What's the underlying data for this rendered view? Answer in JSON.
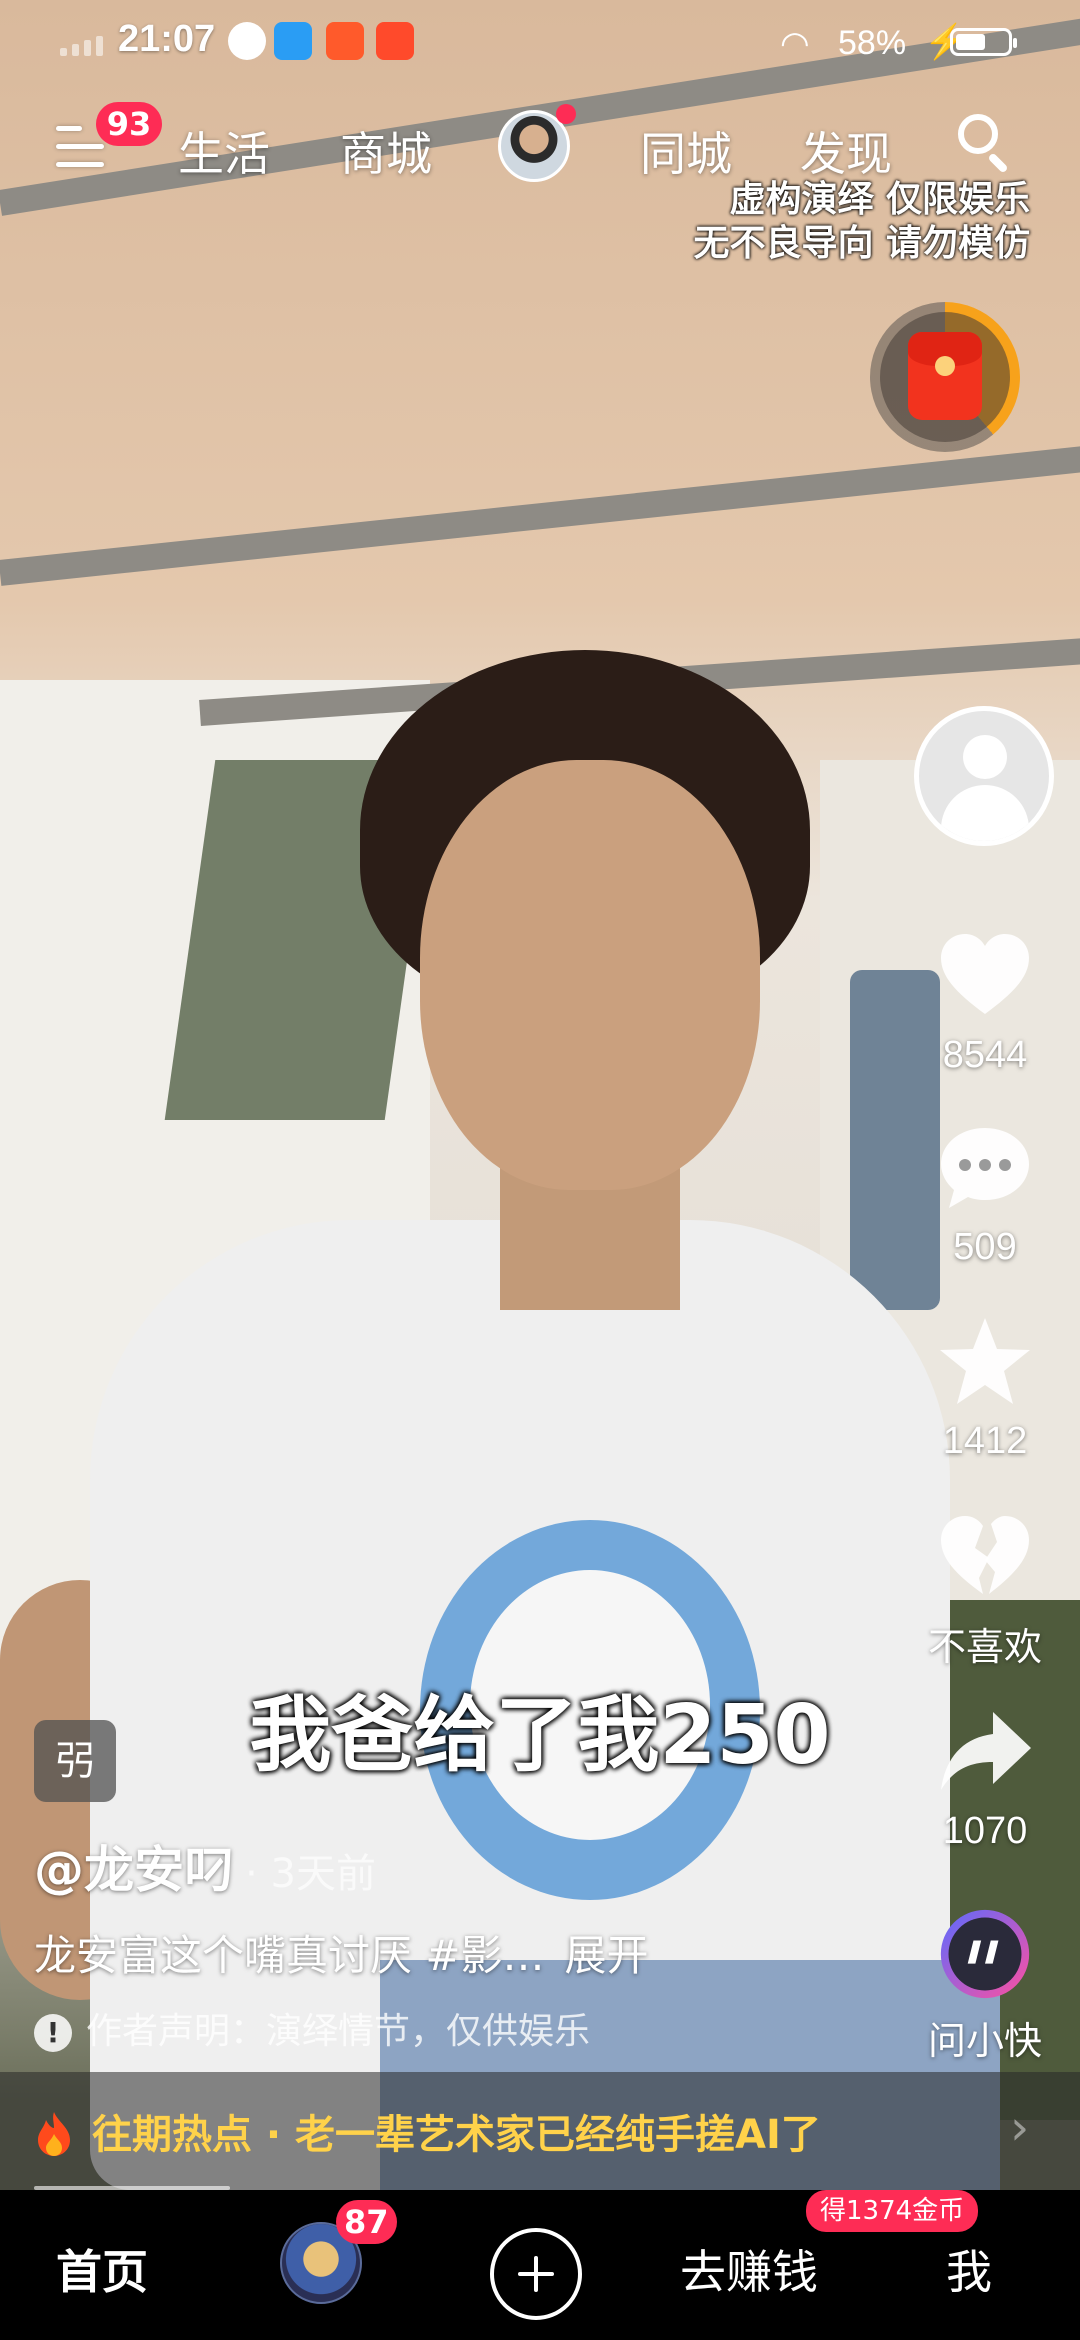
{
  "status_bar": {
    "time": "21:07",
    "battery_percent": "58%",
    "battery_level": 0.58
  },
  "top_nav": {
    "menu_badge": "93",
    "tabs": [
      "生活",
      "商城",
      "同城",
      "发现"
    ]
  },
  "disclaimer": [
    "虚构演绎 仅限娱乐",
    "无不良导向 请勿模仿"
  ],
  "red_packet": {
    "progress": 0.39
  },
  "right_rail": {
    "likes": "8544",
    "comments": "509",
    "favorites": "1412",
    "dislike_label": "不喜欢",
    "shares": "1070",
    "assistant_label": "问小快"
  },
  "video": {
    "subtitle": "我爸给了我250",
    "author_tag": "弜",
    "author": "@龙安叼",
    "time_ago": "· 3天前",
    "description": "龙安富这个嘴真讨厌 #影…",
    "expand_label": "展开",
    "declaration": "作者声明：演绎情节，仅供娱乐"
  },
  "hot_bar": {
    "text": "往期热点 · 老一辈艺术家已经纯手搓AI了"
  },
  "bottom_nav": {
    "home": "首页",
    "avatar_badge": "87",
    "earn": "去赚钱",
    "coin_badge": "得1374金币",
    "me": "我"
  },
  "colors": {
    "accent": "#fe2c55",
    "hot_text": "#ffd24a",
    "red_packet_ring": "#f7a21b"
  }
}
